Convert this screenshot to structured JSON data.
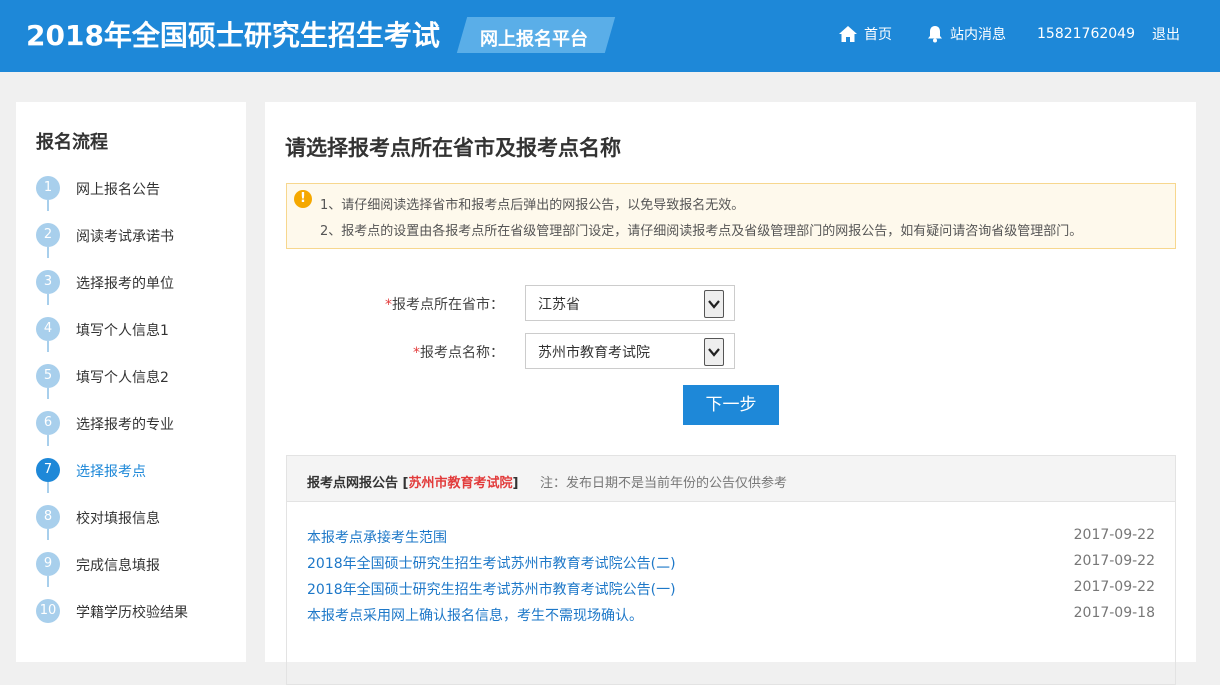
{
  "header": {
    "title": "2018年全国硕士研究生招生考试",
    "badge": "网上报名平台",
    "nav_home": "首页",
    "nav_messages": "站内消息",
    "phone": "15821762049",
    "logout": "退出"
  },
  "sidebar": {
    "title": "报名流程",
    "active_step": 7,
    "steps": [
      {
        "num": "1",
        "label": "网上报名公告"
      },
      {
        "num": "2",
        "label": "阅读考试承诺书"
      },
      {
        "num": "3",
        "label": "选择报考的单位"
      },
      {
        "num": "4",
        "label": "填写个人信息1"
      },
      {
        "num": "5",
        "label": "填写个人信息2"
      },
      {
        "num": "6",
        "label": "选择报考的专业"
      },
      {
        "num": "7",
        "label": "选择报考点"
      },
      {
        "num": "8",
        "label": "校对填报信息"
      },
      {
        "num": "9",
        "label": "完成信息填报"
      },
      {
        "num": "10",
        "label": "学籍学历校验结果"
      }
    ]
  },
  "main": {
    "title": "请选择报考点所在省市及报考点名称",
    "notice": {
      "line1": "1、请仔细阅读选择省市和报考点后弹出的网报公告，以免导致报名无效。",
      "line2": "2、报考点的设置由各报考点所在省级管理部门设定，请仔细阅读报考点及省级管理部门的网报公告，如有疑问请咨询省级管理部门。"
    },
    "form": {
      "province_label": "报考点所在省市：",
      "province_value": "江苏省",
      "site_label": "报考点名称：",
      "site_value": "苏州市教育考试院",
      "required_mark": "*"
    },
    "next_button": "下一步",
    "announcements": {
      "title_prefix": "报考点网报公告 [",
      "title_site": "苏州市教育考试院",
      "title_suffix": "]",
      "note": "注：发布日期不是当前年份的公告仅供参考",
      "items": [
        {
          "title": "本报考点承接考生范围",
          "date": "2017-09-22"
        },
        {
          "title": "2018年全国硕士研究生招生考试苏州市教育考试院公告(二)",
          "date": "2017-09-22"
        },
        {
          "title": "2018年全国硕士研究生招生考试苏州市教育考试院公告(一)",
          "date": "2017-09-22"
        },
        {
          "title": "本报考点采用网上确认报名信息，考生不需现场确认。",
          "date": "2017-09-18"
        }
      ]
    }
  },
  "colors": {
    "brand": "#1e88d8",
    "step_inactive": "#a8cfec",
    "required": "#e23b3b",
    "warning": "#f5a800"
  }
}
